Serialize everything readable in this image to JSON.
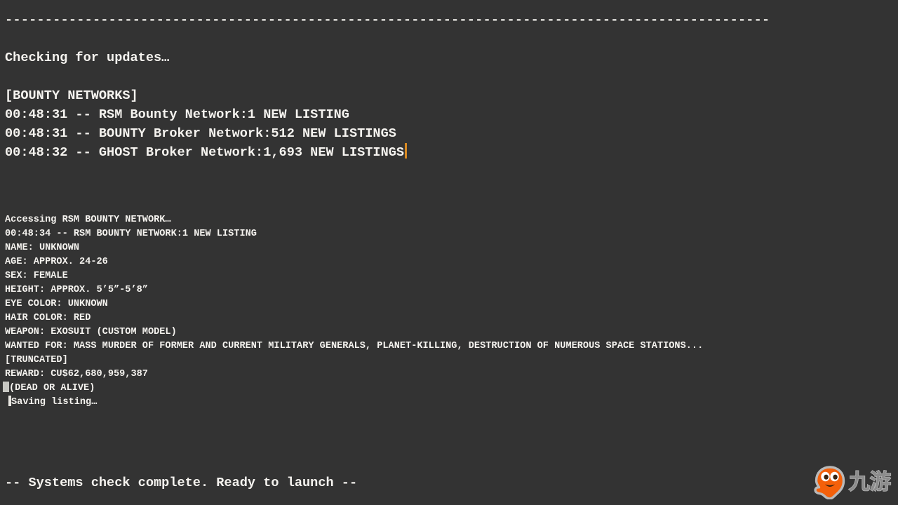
{
  "theme": {
    "background": "#333333",
    "text": "#f5f3ef",
    "caret_accent": "#d98a22",
    "cursor_block": "#c9c9c4",
    "watermark_orange": "#f4600a",
    "watermark_gray": "#8c8c8c"
  },
  "boot": {
    "rule": "------------------------------------------------------------------------------------------------",
    "checking": "Checking for updates…",
    "blank": "",
    "section_header": "[BOUNTY NETWORKS]",
    "network_lines": [
      "00:48:31 -- RSM Bounty Network:1 NEW LISTING",
      "00:48:31 -- BOUNTY Broker Network:512 NEW LISTINGS",
      "00:48:32 -- GHOST Broker Network:1,693 NEW LISTINGS"
    ]
  },
  "listing": {
    "accessing": "Accessing RSM BOUNTY NETWORK…",
    "timestamp_line": "00:48:34 -- RSM BOUNTY NETWORK:1 NEW LISTING",
    "fields": [
      "NAME: UNKNOWN",
      "AGE: APPROX. 24-26",
      "SEX: FEMALE",
      "HEIGHT: APPROX. 5’5”-5’8”",
      "EYE COLOR: UNKNOWN",
      "HAIR COLOR: RED",
      "WEAPON: EXOSUIT (CUSTOM MODEL)",
      "WANTED FOR: MASS MURDER OF FORMER AND CURRENT MILITARY GENERALS, PLANET-KILLING, DESTRUCTION OF NUMEROUS SPACE STATIONS...",
      "[TRUNCATED]",
      "REWARD: CU$62,680,959,387"
    ],
    "dead_or_alive": "(DEAD OR ALIVE)",
    "saving": "Saving listing…"
  },
  "footer": {
    "status": "-- Systems check complete. Ready to launch --"
  },
  "watermark": {
    "wordmark": "九游",
    "mascot_name": "jiuyou-mascot-icon"
  }
}
